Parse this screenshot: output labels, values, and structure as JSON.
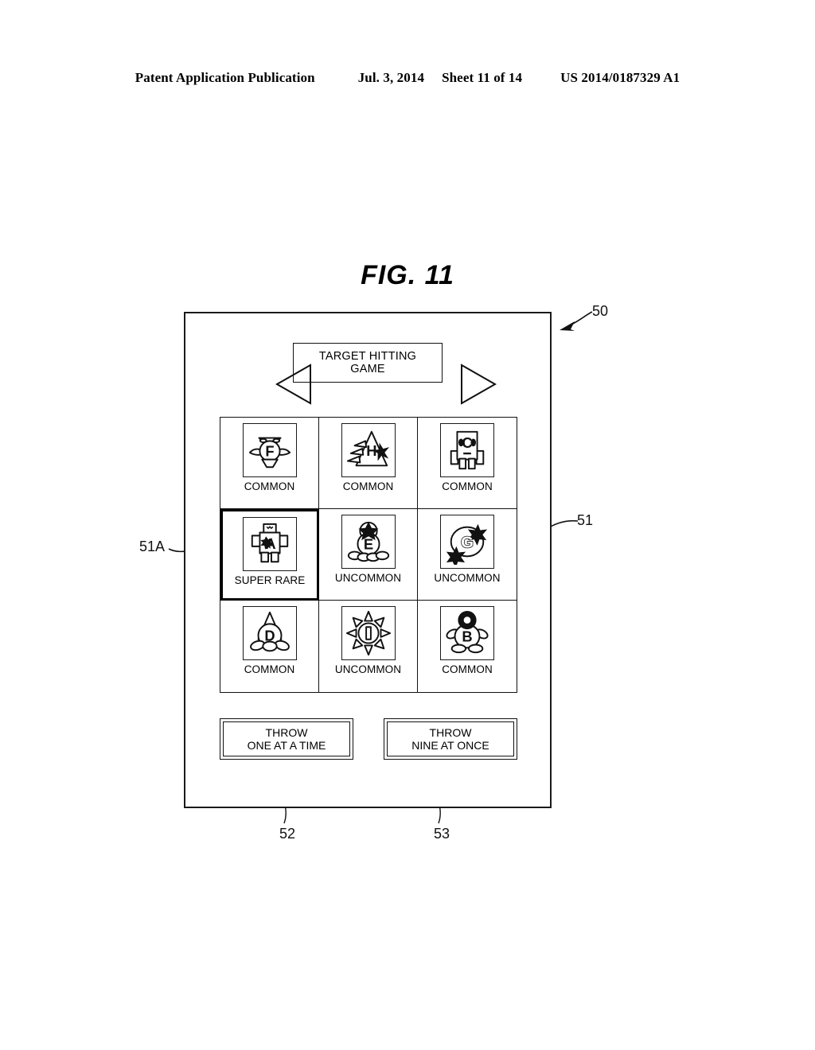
{
  "header": {
    "publication": "Patent Application Publication",
    "date": "Jul. 3, 2014",
    "sheet": "Sheet 11 of 14",
    "patent_number": "US 2014/0187329 A1"
  },
  "figure": {
    "label": "FIG. 11"
  },
  "device": {
    "ref": "50",
    "title_bar": {
      "prev_arrow": "triangle-left-icon",
      "next_arrow": "triangle-right-icon",
      "title_line1": "TARGET HITTING",
      "title_line2": "GAME"
    },
    "grid": {
      "ref": "51",
      "selected_ref": "51A",
      "cells": [
        {
          "letter": "F",
          "rarity": "COMMON",
          "icon": "character-f-icon",
          "selected": false
        },
        {
          "letter": "H",
          "rarity": "COMMON",
          "icon": "character-h-icon",
          "selected": false
        },
        {
          "letter": "C",
          "rarity": "COMMON",
          "icon": "character-c-icon",
          "selected": false
        },
        {
          "letter": "A",
          "rarity": "SUPER RARE",
          "icon": "character-a-icon",
          "selected": true
        },
        {
          "letter": "E",
          "rarity": "UNCOMMON",
          "icon": "character-e-icon",
          "selected": false
        },
        {
          "letter": "G",
          "rarity": "UNCOMMON",
          "icon": "character-g-icon",
          "selected": false
        },
        {
          "letter": "D",
          "rarity": "COMMON",
          "icon": "character-d-icon",
          "selected": false
        },
        {
          "letter": "I",
          "rarity": "UNCOMMON",
          "icon": "character-i-icon",
          "selected": false
        },
        {
          "letter": "B",
          "rarity": "COMMON",
          "icon": "character-b-icon",
          "selected": false
        }
      ]
    },
    "buttons": [
      {
        "ref": "52",
        "line1": "THROW",
        "line2": "ONE AT A TIME"
      },
      {
        "ref": "53",
        "line1": "THROW",
        "line2": "NINE AT ONCE"
      }
    ]
  },
  "colors": {
    "line": "#111111",
    "background": "#ffffff"
  }
}
